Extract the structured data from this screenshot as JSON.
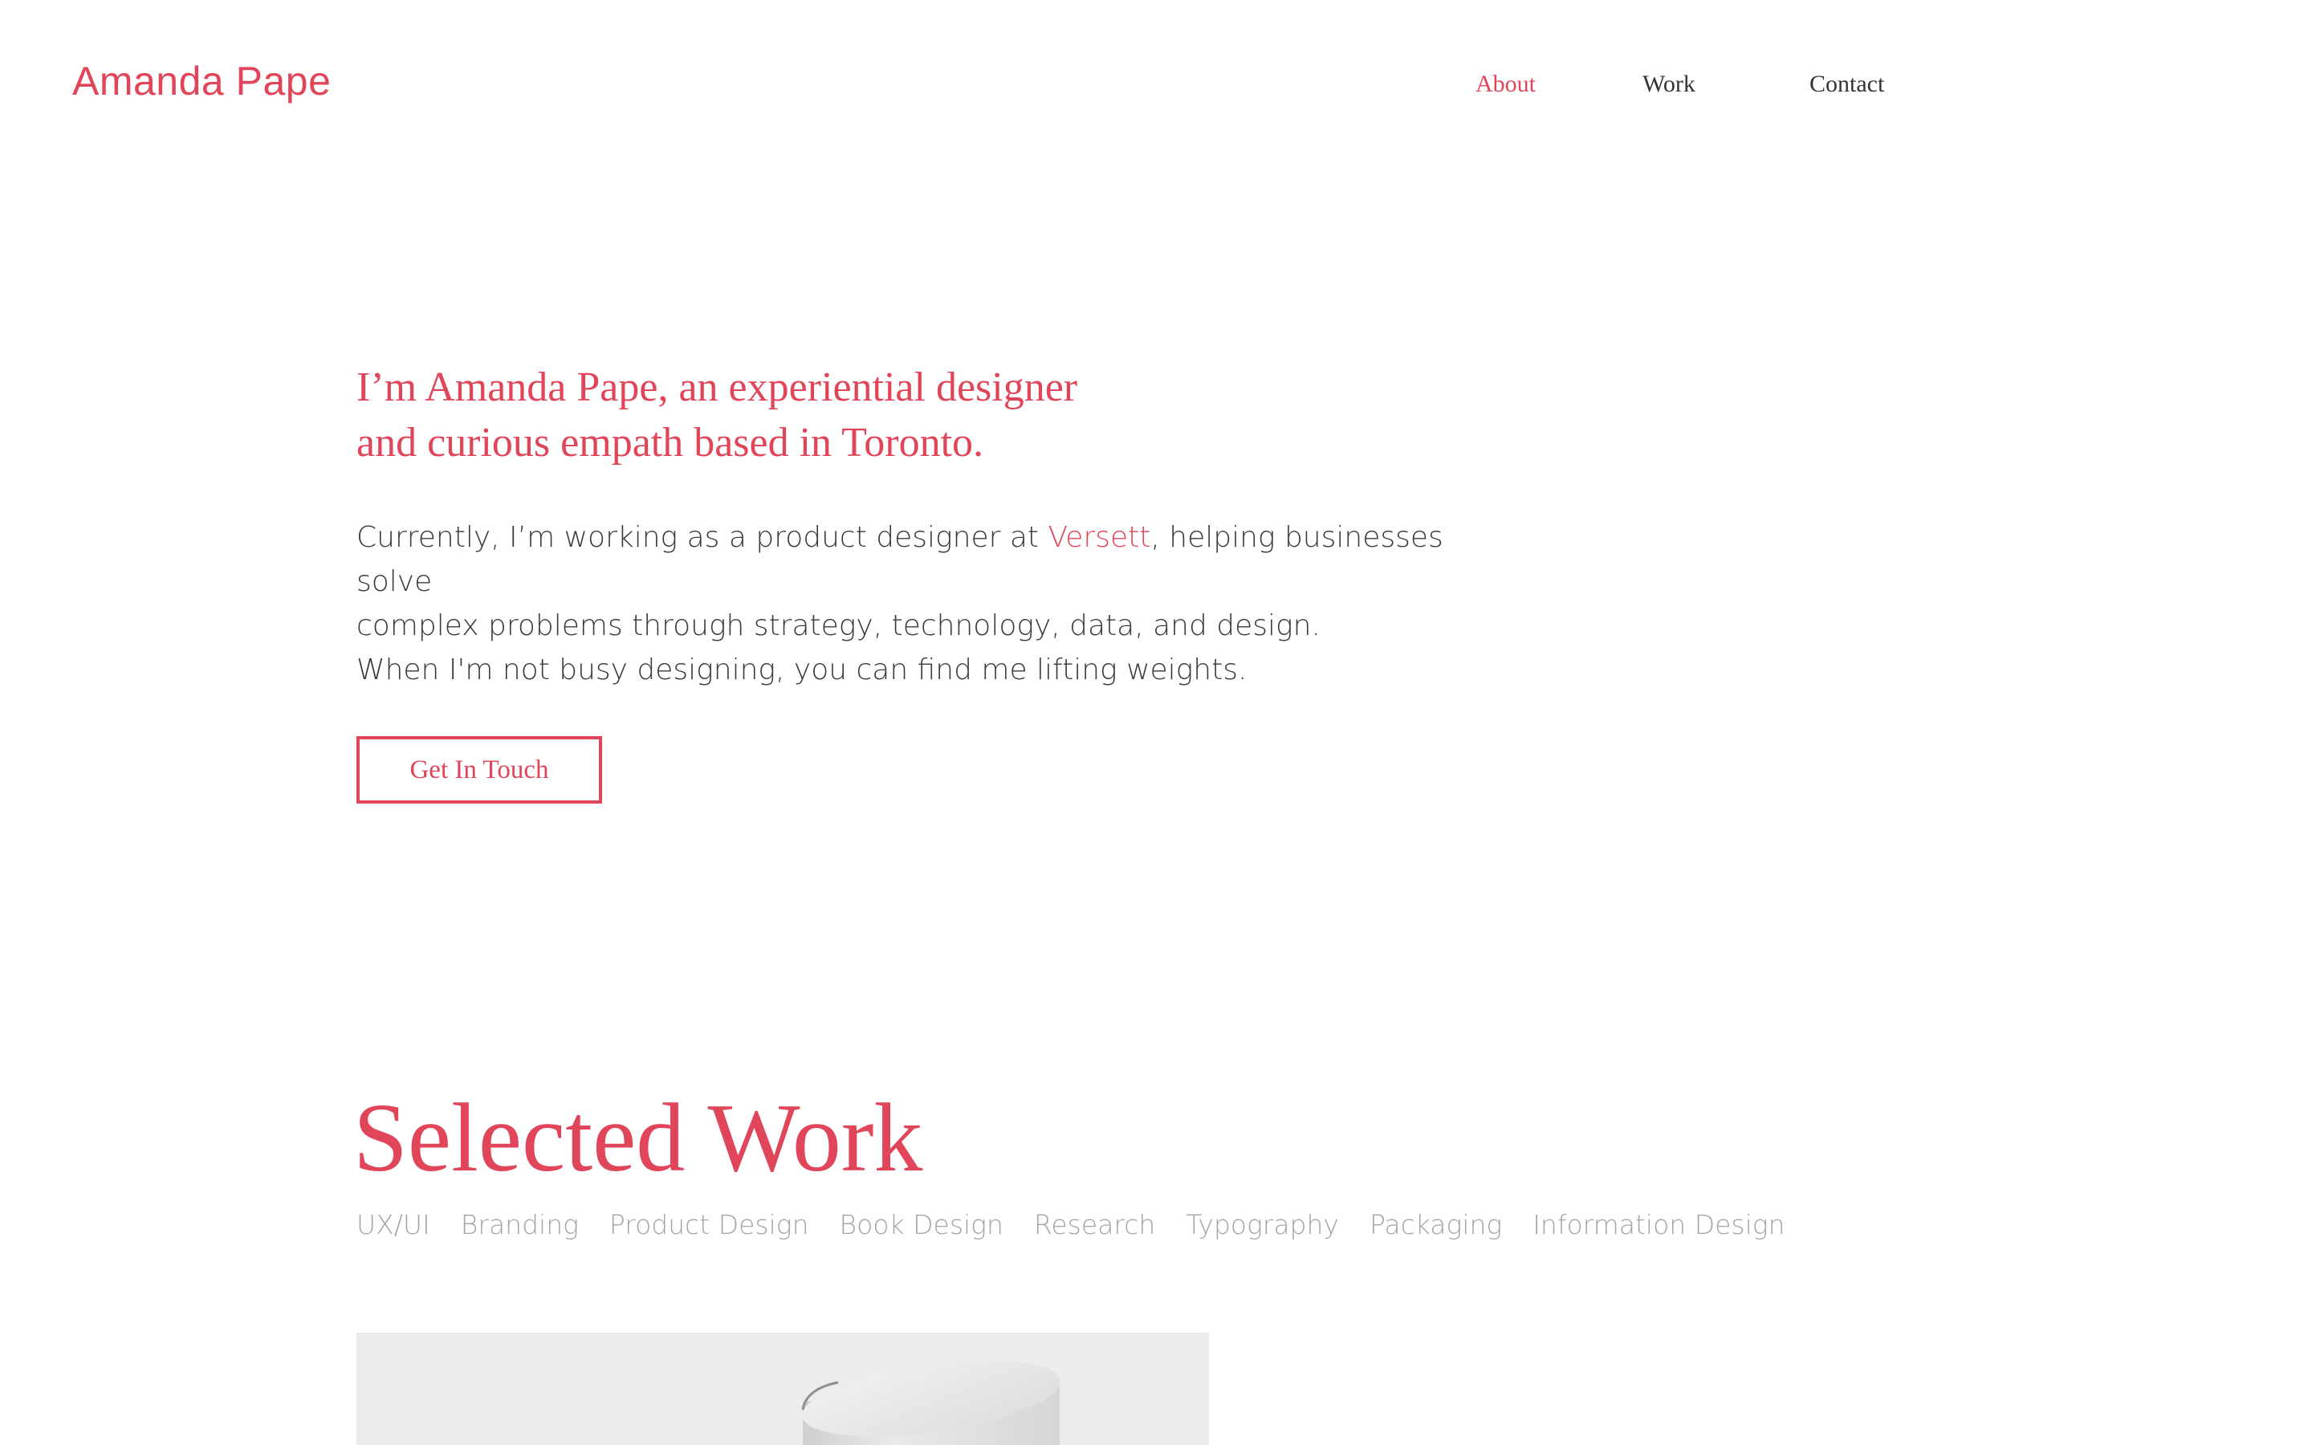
{
  "header": {
    "brand": "Amanda Pape",
    "nav": [
      {
        "label": "About",
        "active": true
      },
      {
        "label": "Work",
        "active": false
      },
      {
        "label": "Contact",
        "active": false
      }
    ]
  },
  "intro": {
    "headline_line1": "I’m Amanda Pape, an experiential designer",
    "headline_line2": "and curious empath based in Toronto.",
    "para1_before": "Currently, I’m working as a product designer at ",
    "para1_link": "Versett",
    "para1_after_line1": ", helping businesses solve",
    "para1_line2": "complex problems through strategy, technology, data, and design.",
    "para2": "When I'm not busy designing, you can find me lifting weights.",
    "cta_label": "Get In Touch"
  },
  "work": {
    "title": "Selected Work",
    "filters": [
      "UX/UI",
      "Branding",
      "Product Design",
      "Book Design",
      "Research",
      "Typography",
      "Packaging",
      "Information Design"
    ],
    "card_image_icon": "product-render-image"
  },
  "colors": {
    "accent": "#e0455a",
    "text": "#3a3a3a",
    "muted": "#a4a4a4",
    "card_bg": "#ececec"
  }
}
